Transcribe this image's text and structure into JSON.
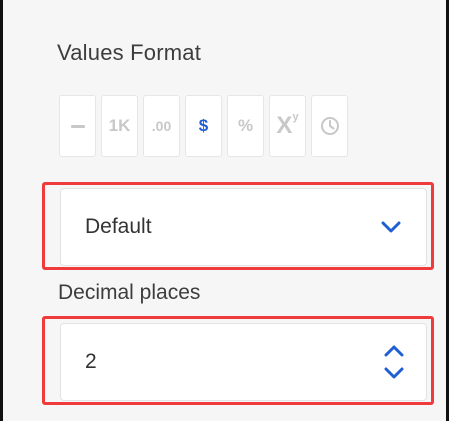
{
  "values_format": {
    "title": "Values Format",
    "buttons": [
      {
        "name": "minus",
        "label": "",
        "active": false
      },
      {
        "name": "thousands",
        "label": "1K",
        "active": false
      },
      {
        "name": "decimals",
        "label": ".00",
        "active": false
      },
      {
        "name": "currency",
        "label": "$",
        "active": true
      },
      {
        "name": "percent",
        "label": "%",
        "active": false
      },
      {
        "name": "power",
        "label": "X",
        "sup": "y",
        "active": false
      },
      {
        "name": "time",
        "label": "",
        "active": false
      }
    ]
  },
  "format_select": {
    "value": "Default"
  },
  "decimal_places": {
    "label": "Decimal places",
    "value": "2"
  },
  "colors": {
    "accent": "#1f5fd1",
    "highlight": "#ef3b3b",
    "disabled": "#c8c8c8"
  },
  "icons": {
    "dropdown": "chevron-down-icon",
    "step_up": "chevron-up-icon",
    "step_down": "chevron-down-icon",
    "time": "clock-icon"
  }
}
